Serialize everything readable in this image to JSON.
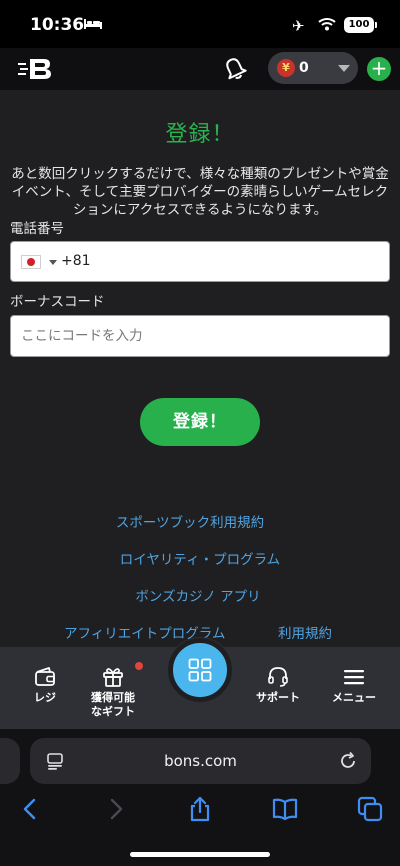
{
  "status_bar": {
    "time": "10:36",
    "battery": "100"
  },
  "header": {
    "balance_value": "0",
    "currency_symbol": "¥"
  },
  "main": {
    "title": "登録！",
    "description": "あと数回クリックするだけで、様々な種類のプレゼントや賞金イベント、そして主要プロバイダーの素晴らしいゲームセレクションにアクセスできるようになります。",
    "phone_label": "電話番号",
    "phone_code": "+81",
    "bonus_label": "ボーナスコード",
    "bonus_placeholder": "ここにコードを入力",
    "register_button": "登録！"
  },
  "links": {
    "sportsbook_terms": "スポーツブック利用規約",
    "loyalty_program": "ロイヤリティ・プログラム",
    "casino_app": "ボンズカジノ アプリ",
    "affiliate_program": "アフィリエイトプログラム",
    "terms": "利用規約"
  },
  "bottom_nav": {
    "cashier": "レジ",
    "gifts_line1": "獲得可能",
    "gifts_line2": "なギフト",
    "support": "サポート",
    "menu": "メニュー"
  },
  "browser": {
    "url": "bons.com"
  },
  "colors": {
    "accent_green": "#27b04b",
    "link_blue": "#4fa3e0",
    "fab_blue": "#4bb6ee",
    "background": "#1f1f22"
  }
}
